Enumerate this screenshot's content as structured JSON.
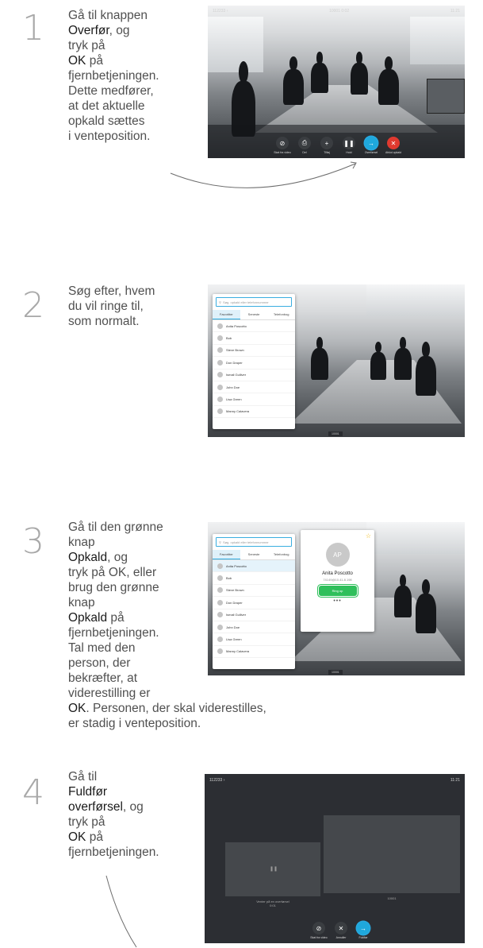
{
  "steps": [
    {
      "number": "1",
      "lines": [
        {
          "t": "Gå til knappen"
        },
        {
          "b": "Overfør",
          "t": ", og"
        },
        {
          "t": "tryk på "
        },
        {
          "b": "OK",
          "t": " på"
        },
        {
          "t": "fjernbetjeningen."
        },
        {
          "t": "Dette medfører,"
        },
        {
          "t": "at det aktuelle"
        },
        {
          "t": "opkald sættes"
        },
        {
          "t": "i venteposition."
        }
      ]
    },
    {
      "number": "2",
      "lines": [
        {
          "t": "Søg efter, hvem"
        },
        {
          "t": "du vil ringe til,"
        },
        {
          "t": "som normalt."
        }
      ]
    },
    {
      "number": "3",
      "lines": [
        {
          "t": "Gå til den grønne"
        },
        {
          "t": "knap "
        },
        {
          "b": "Opkald",
          "t": ", og"
        },
        {
          "t": "tryk på OK, eller"
        },
        {
          "t": "brug den grønne"
        },
        {
          "t": "knap "
        },
        {
          "b": "Opkald",
          "t": " på"
        },
        {
          "t": "fjernbetjeningen."
        },
        {
          "t": "Tal med den"
        },
        {
          "t": "person, der"
        },
        {
          "t": "bekræfter, at"
        },
        {
          "t": "viderestilling er"
        },
        {
          "b": "OK",
          "t": ". Personen, der skal viderestilles,"
        },
        {
          "t": "er stadig i venteposition."
        }
      ]
    },
    {
      "number": "4",
      "lines": [
        {
          "t": "Gå til "
        },
        {
          "b": "Fuldfør"
        },
        {
          "b": "overførsel",
          "t": ", og"
        },
        {
          "t": "tryk på "
        },
        {
          "b": "OK",
          "t": " på"
        },
        {
          "t": "fjernbetjeningen."
        }
      ]
    }
  ],
  "shot1": {
    "topbar_left": "112233 ›",
    "topbar_center": "10001 0:02",
    "topbar_right": "11:21",
    "controls": [
      {
        "icon": "⊘",
        "label": "Skat fra video",
        "color": "dark"
      },
      {
        "icon": "⎙",
        "label": "Del",
        "color": "dark"
      },
      {
        "icon": "+",
        "label": "Tilføj",
        "color": "dark"
      },
      {
        "icon": "❚❚",
        "label": "Hold",
        "color": "dark"
      },
      {
        "icon": "→",
        "label": "Overførsel",
        "color": "blue"
      },
      {
        "icon": "✕",
        "label": "Afslut opkald",
        "color": "red"
      }
    ]
  },
  "shot2": {
    "search_placeholder": "Søg, opkald eller telefonnummer",
    "tabs": [
      "Favoritter",
      "Seneste",
      "Telefonbog"
    ],
    "contacts": [
      "Anita Poscotto",
      "Bob",
      "Steve Brown",
      "Don Draper",
      "Ismail Gulliver",
      "John Doe",
      "Lisa Green",
      "Manny Calavera"
    ],
    "number_tag": "10001"
  },
  "shot3": {
    "search_placeholder": "Søg, opkald eller telefonnummer",
    "tabs": [
      "Favoritter",
      "Seneste",
      "Telefonbog"
    ],
    "contacts": [
      "Anita Poscotto",
      "Bob",
      "Steve Brown",
      "Don Draper",
      "Ismail Gulliver",
      "John Doe",
      "Lisa Green",
      "Manny Calavera"
    ],
    "card_initials": "AP",
    "card_name": "Anita Poscotto",
    "card_number": "74149@10.41.8.198",
    "card_call": "Ring op",
    "card_more": "•••",
    "number_tag": "10001"
  },
  "shot4": {
    "topbar_left": "112233 ›",
    "topbar_right": "11:21",
    "tile_left_label": "Venter på en overførsel",
    "tile_left_time": "0:01",
    "tile_right_label": "10001",
    "controls": [
      {
        "icon": "⊘",
        "label": "Skat fra video",
        "color": "dark"
      },
      {
        "icon": "✕",
        "label": "Annuller",
        "color": "dark"
      },
      {
        "icon": "→",
        "label": "Fuldfør",
        "color": "blue"
      }
    ]
  }
}
